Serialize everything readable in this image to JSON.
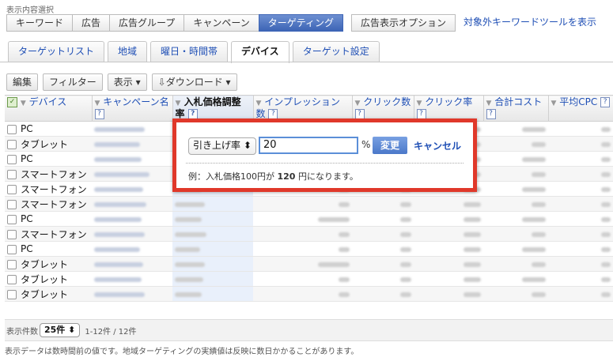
{
  "header": {
    "section_label": "表示内容選択"
  },
  "top_buttons": [
    {
      "label": "キーワード",
      "active": false
    },
    {
      "label": "広告",
      "active": false
    },
    {
      "label": "広告グループ",
      "active": false
    },
    {
      "label": "キャンペーン",
      "active": false
    },
    {
      "label": "ターゲティング",
      "active": true
    }
  ],
  "ad_options_button": "広告表示オプション",
  "excluded_keyword_link": "対象外キーワードツールを表示",
  "tabs": [
    {
      "label": "ターゲットリスト",
      "active": false
    },
    {
      "label": "地域",
      "active": false
    },
    {
      "label": "曜日・時間帯",
      "active": false
    },
    {
      "label": "デバイス",
      "active": true
    },
    {
      "label": "ターゲット設定",
      "active": false
    }
  ],
  "toolbar": {
    "edit": "編集",
    "filter": "フィルター",
    "display": "表示 ▾",
    "download": "ダウンロード ▾"
  },
  "columns": {
    "device": "デバイス",
    "campaign": "キャンペーン名",
    "bid_adjust": "入札価格調整率",
    "impressions": "インプレッション数",
    "clicks": "クリック数",
    "ctr": "クリック率",
    "cost": "合計コスト",
    "avg_cpc": "平均CPC",
    "help": "?"
  },
  "rows": [
    {
      "device": "PC"
    },
    {
      "device": "タブレット"
    },
    {
      "device": "PC"
    },
    {
      "device": "スマートフォン"
    },
    {
      "device": "スマートフォン"
    },
    {
      "device": "スマートフォン"
    },
    {
      "device": "PC"
    },
    {
      "device": "スマートフォン"
    },
    {
      "device": "PC"
    },
    {
      "device": "タブレット"
    },
    {
      "device": "タブレット"
    },
    {
      "device": "タブレット"
    }
  ],
  "popup": {
    "mode": "引き上げ率 ⬍",
    "value": "20",
    "unit": "%",
    "apply": "変更",
    "cancel": "キャンセル",
    "example_pre": "例：入札価格100円が ",
    "example_value": "120",
    "example_post": " 円になります。"
  },
  "footer": {
    "page_size_label": "表示件数",
    "page_size": "25件 ⬍",
    "range": "1-12件 / 12件",
    "note": "表示データは数時間前の値です。地域ターゲティングの実績値は反映に数日かかることがあります。"
  },
  "colors": {
    "accent": "#3d65b6",
    "link": "#1f4fb5",
    "alert_border": "#e0382a"
  }
}
